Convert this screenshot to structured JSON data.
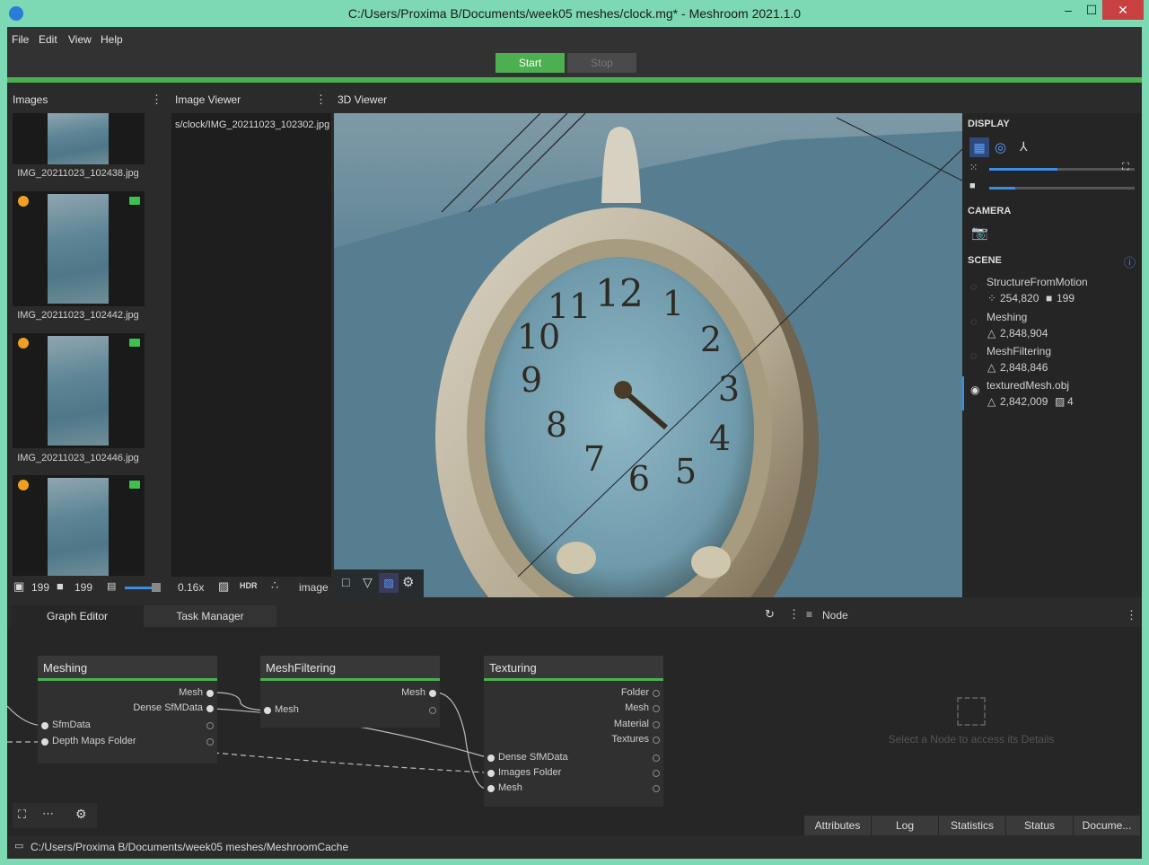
{
  "window": {
    "title": "C:/Users/Proxima B/Documents/week05 meshes/clock.mg* - Meshroom 2021.1.0",
    "controls": {
      "minimize": "–",
      "maximize": "☐",
      "close": "✕"
    }
  },
  "menu": [
    "File",
    "Edit",
    "View",
    "Help"
  ],
  "toolbar": {
    "start_label": "Start",
    "stop_label": "Stop"
  },
  "images_panel": {
    "title": "Images",
    "items": [
      {
        "label": "IMG_20211023_102438.jpg"
      },
      {
        "label": "IMG_20211023_102442.jpg"
      },
      {
        "label": "IMG_20211023_102446.jpg"
      },
      {
        "label": ""
      }
    ],
    "footer": {
      "images_count": "199",
      "cameras_count": "199"
    }
  },
  "image_viewer": {
    "title": "Image Viewer",
    "path": "s/clock/IMG_20211023_102302.jpg",
    "zoom": "0.16x",
    "hdr_label": "HDR",
    "mode": "image"
  },
  "viewer3d": {
    "title": "3D Viewer",
    "clock_numerals": [
      "12",
      "1",
      "2",
      "3",
      "4",
      "5",
      "6",
      "7",
      "8",
      "9",
      "10",
      "11"
    ]
  },
  "display": {
    "title": "DISPLAY",
    "point_size_slider": 0.47,
    "camera_scale_slider": 0.18,
    "camera_title": "CAMERA",
    "scene_title": "SCENE",
    "scene_items": [
      {
        "name": "StructureFromMotion",
        "stats": "254,820",
        "stats2": "199"
      },
      {
        "name": "Meshing",
        "stats": "2,848,904",
        "stats2": ""
      },
      {
        "name": "MeshFiltering",
        "stats": "2,848,846",
        "stats2": ""
      },
      {
        "name": "texturedMesh.obj",
        "stats": "2,842,009",
        "stats2": "4"
      }
    ]
  },
  "graph_editor": {
    "tabs": [
      "Graph Editor",
      "Task Manager"
    ],
    "nodes": [
      {
        "title": "Meshing",
        "outputs": [
          "Mesh",
          "Dense SfMData"
        ],
        "inputs": [
          "SfmData",
          "Depth Maps Folder"
        ]
      },
      {
        "title": "MeshFiltering",
        "outputs": [
          "Mesh"
        ],
        "inputs": [
          "Mesh"
        ]
      },
      {
        "title": "Texturing",
        "outputs": [
          "Folder",
          "Mesh",
          "Material",
          "Textures"
        ],
        "inputs": [
          "Dense SfMData",
          "Images Folder",
          "Mesh"
        ]
      }
    ]
  },
  "node_panel": {
    "title": "Node",
    "placeholder": "Select a Node to access its Details",
    "tabs": [
      "Attributes",
      "Log",
      "Statistics",
      "Status",
      "Docume..."
    ]
  },
  "statusbar": {
    "path": "C:/Users/Proxima B/Documents/week05 meshes/MeshroomCache"
  },
  "colors": {
    "accent": "#4caf50",
    "titlebar": "#7dd9b4",
    "close": "#c94040"
  }
}
